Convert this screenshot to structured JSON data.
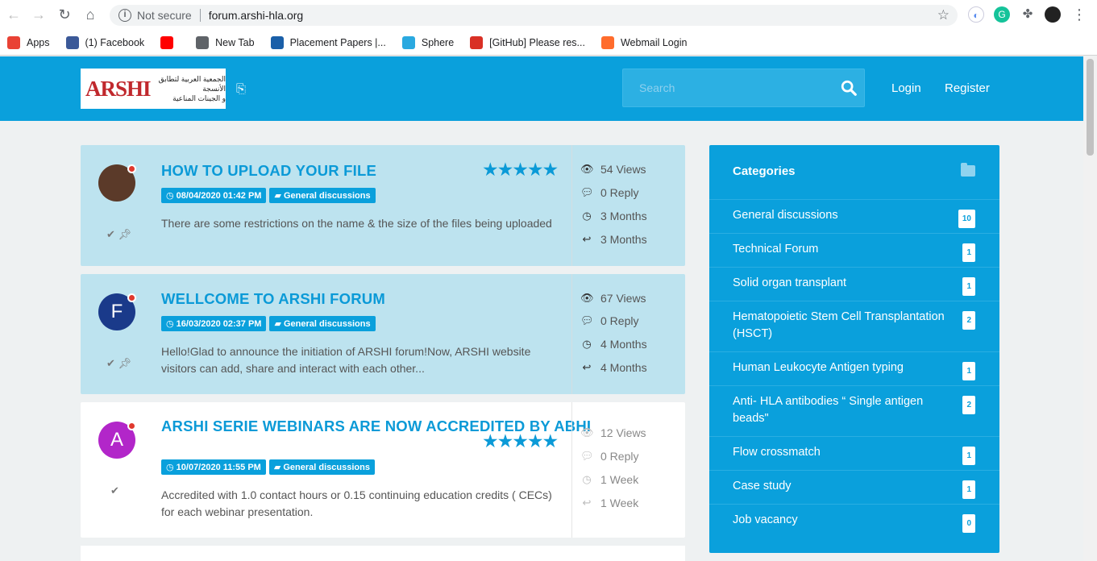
{
  "browser": {
    "security_label": "Not secure",
    "url": "forum.arshi-hla.org",
    "bookmarks": [
      {
        "label": "Apps",
        "icon": "apps-grid-icon",
        "color": "#e94235"
      },
      {
        "label": "(1) Facebook",
        "icon": "facebook-icon",
        "color": "#3b5998"
      },
      {
        "label": "",
        "icon": "youtube-icon",
        "color": "#ff0000"
      },
      {
        "label": "New Tab",
        "icon": "globe-icon",
        "color": "#5f6368"
      },
      {
        "label": "Placement Papers |...",
        "icon": "vw-icon",
        "color": "#1a5fa8"
      },
      {
        "label": "Sphere",
        "icon": "sphere-icon",
        "color": "#2aa9e0"
      },
      {
        "label": "[GitHub] Please res...",
        "icon": "gmail-icon",
        "color": "#d93025"
      },
      {
        "label": "Webmail Login",
        "icon": "cpanel-icon",
        "color": "#ff6c2c"
      }
    ]
  },
  "header": {
    "logo_text": "ARSHI",
    "logo_arabic_line1": "الجمعية العربية لتطابق الأنسجة",
    "logo_arabic_line2": "و الجينات المناعية",
    "search_placeholder": "Search",
    "login": "Login",
    "register": "Register"
  },
  "topics": [
    {
      "title": "HOW TO UPLOAD YOUR FILE",
      "date": "08/04/2020 01:42 PM",
      "category": "General discussions",
      "excerpt": "There are some restrictions on the name & the size of the files being uploaded",
      "views": "54 Views",
      "replies": "0 Reply",
      "created": "3 Months",
      "last_reply": "3 Months",
      "stars": "★★★★★",
      "avatar_letter": "",
      "avatar_color": "#5b3a29",
      "pinned": true
    },
    {
      "title": "WELLCOME TO ARSHI FORUM",
      "date": "16/03/2020 02:37 PM",
      "category": "General discussions",
      "excerpt": "Hello!Glad to announce the initiation of ARSHI forum!Now, ARSHI website visitors can add, share and interact with each other...",
      "views": "67 Views",
      "replies": "0 Reply",
      "created": "4 Months",
      "last_reply": "4 Months",
      "stars": "",
      "avatar_letter": "F",
      "avatar_color": "#1a3a8a",
      "pinned": true
    },
    {
      "title": "ARSHI SERIE WEBINARS ARE NOW ACCREDITED BY ABHI",
      "date": "10/07/2020 11:55 PM",
      "category": "General discussions",
      "excerpt": "Accredited with 1.0 contact hours or 0.15 continuing education credits ( CECs) for each webinar presentation.",
      "views": "12 Views",
      "replies": "0 Reply",
      "created": "1 Week",
      "last_reply": "1 Week",
      "stars": "★★★★★",
      "avatar_letter": "A",
      "avatar_color": "#b226c9",
      "pinned": false
    }
  ],
  "sidebar": {
    "title": "Categories",
    "categories": [
      {
        "name": "General discussions",
        "count": "10"
      },
      {
        "name": "Technical Forum",
        "count": "1"
      },
      {
        "name": "Solid organ transplant",
        "count": "1"
      },
      {
        "name": "Hematopoietic Stem Cell Transplantation (HSCT)",
        "count": "2"
      },
      {
        "name": "Human Leukocyte Antigen typing",
        "count": "1"
      },
      {
        "name": "Anti- HLA antibodies “ Single antigen beads\"",
        "count": "2"
      },
      {
        "name": "Flow crossmatch",
        "count": "1"
      },
      {
        "name": "Case study",
        "count": "1"
      },
      {
        "name": "Job vacancy",
        "count": "0"
      }
    ]
  },
  "colors": {
    "brand": "#0aa0dc",
    "pinned_bg": "#bde3ef"
  }
}
